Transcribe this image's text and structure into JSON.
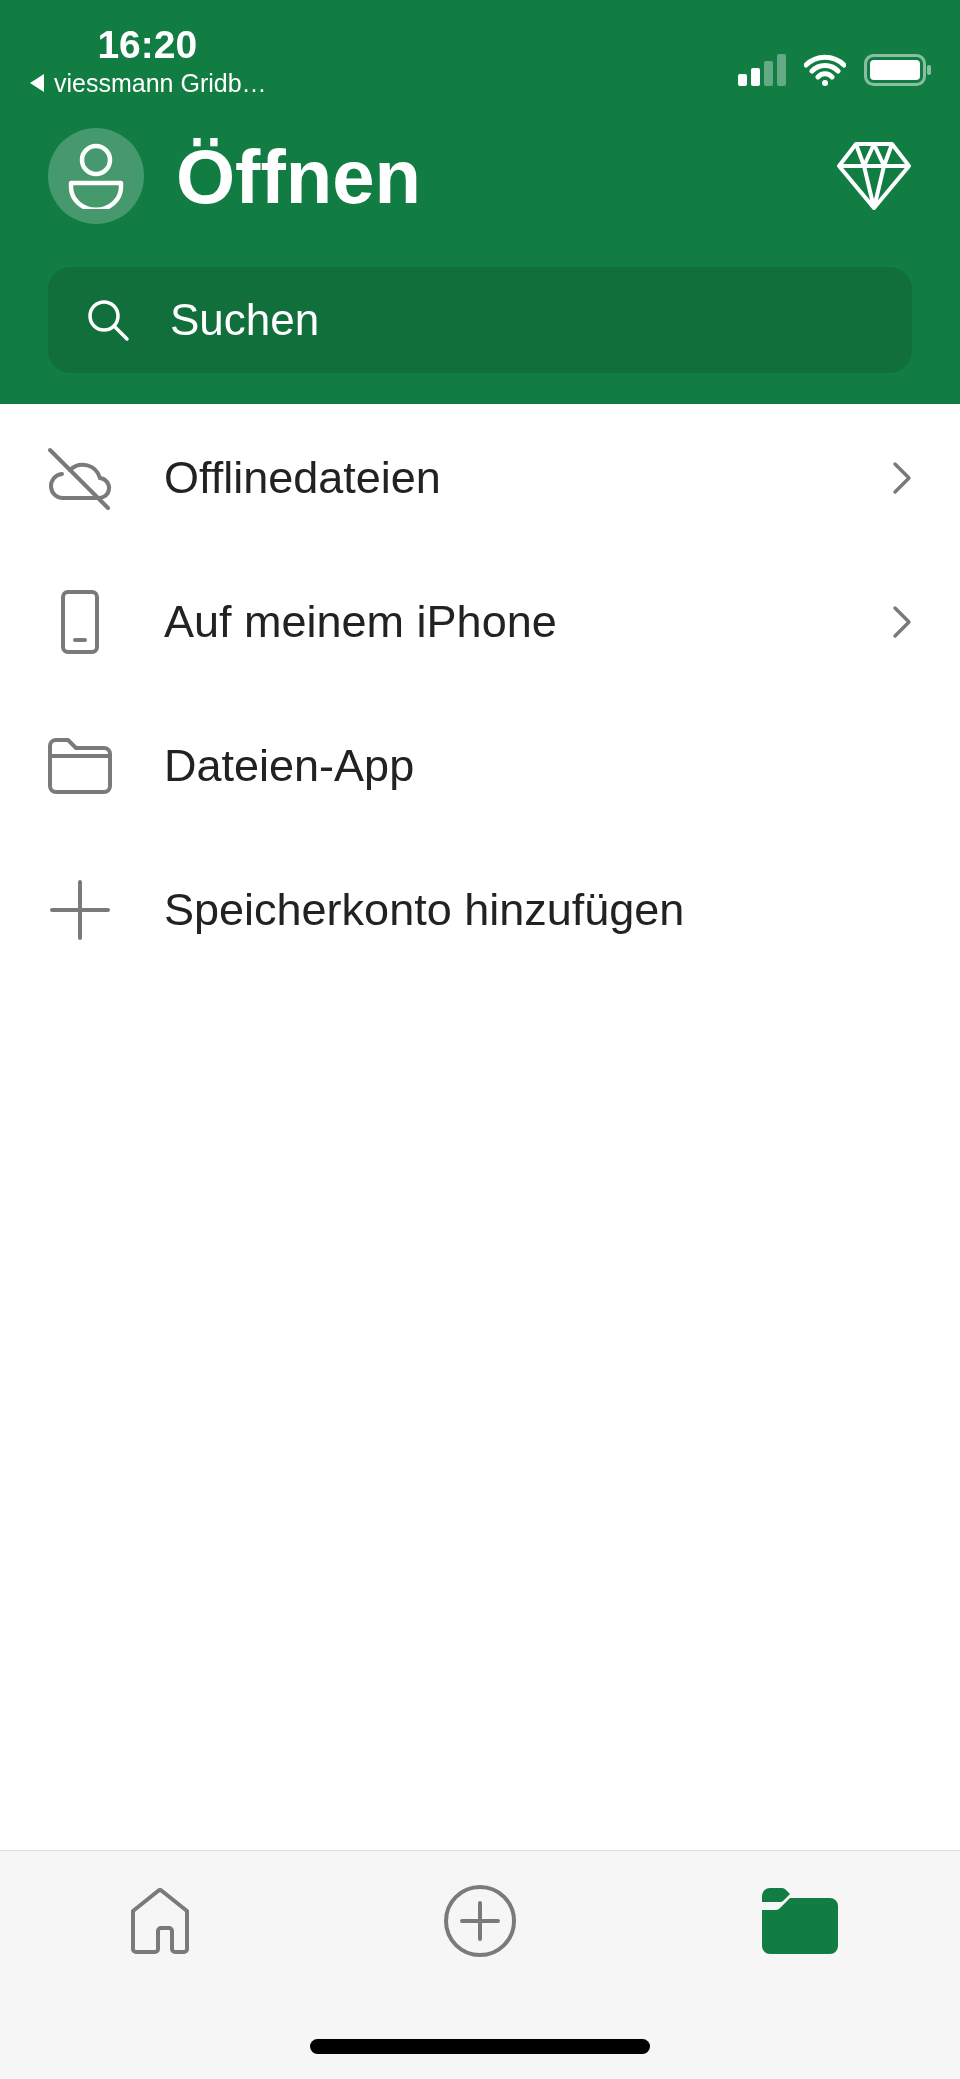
{
  "status_bar": {
    "time": "16:20",
    "back_label": "viessmann Gridb…"
  },
  "header": {
    "title": "Öffnen",
    "search": {
      "placeholder": "Suchen"
    }
  },
  "items": [
    {
      "kind": "offline",
      "label": "Offlinedateien",
      "chevron": true
    },
    {
      "kind": "device",
      "label": "Auf meinem iPhone",
      "chevron": true
    },
    {
      "kind": "files",
      "label": "Dateien-App",
      "chevron": false
    },
    {
      "kind": "add",
      "label": "Speicherkonto hinzufügen",
      "chevron": false
    }
  ],
  "tab_bar": [
    {
      "kind": "home",
      "selected": false
    },
    {
      "kind": "create",
      "selected": false
    },
    {
      "kind": "open",
      "selected": true
    }
  ]
}
